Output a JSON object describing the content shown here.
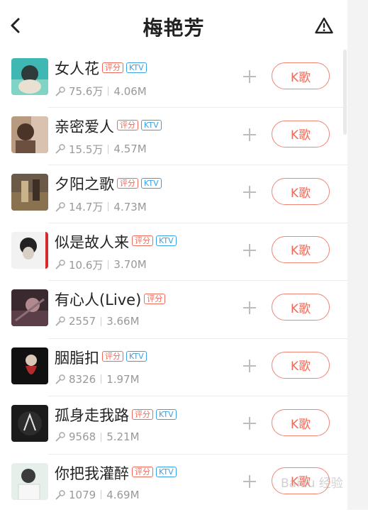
{
  "header": {
    "title": "梅艳芳"
  },
  "tags": {
    "score": "评分",
    "ktv": "KTV"
  },
  "k_label": "K歌",
  "songs": [
    {
      "title": "女人花",
      "plays": "75.6万",
      "size": "4.06M",
      "score": true,
      "ktv": true
    },
    {
      "title": "亲密爱人",
      "plays": "15.5万",
      "size": "4.57M",
      "score": true,
      "ktv": true
    },
    {
      "title": "夕阳之歌",
      "plays": "14.7万",
      "size": "4.73M",
      "score": true,
      "ktv": true
    },
    {
      "title": "似是故人来",
      "plays": "10.6万",
      "size": "3.70M",
      "score": true,
      "ktv": true
    },
    {
      "title": "有心人(Live)",
      "plays": "2557",
      "size": "3.66M",
      "score": true,
      "ktv": false
    },
    {
      "title": "胭脂扣",
      "plays": "8326",
      "size": "1.97M",
      "score": true,
      "ktv": true
    },
    {
      "title": "孤身走我路",
      "plays": "9568",
      "size": "5.21M",
      "score": true,
      "ktv": true
    },
    {
      "title": "你把我灌醉",
      "plays": "1079",
      "size": "4.69M",
      "score": true,
      "ktv": true
    }
  ],
  "watermark": "Baidu 经验"
}
